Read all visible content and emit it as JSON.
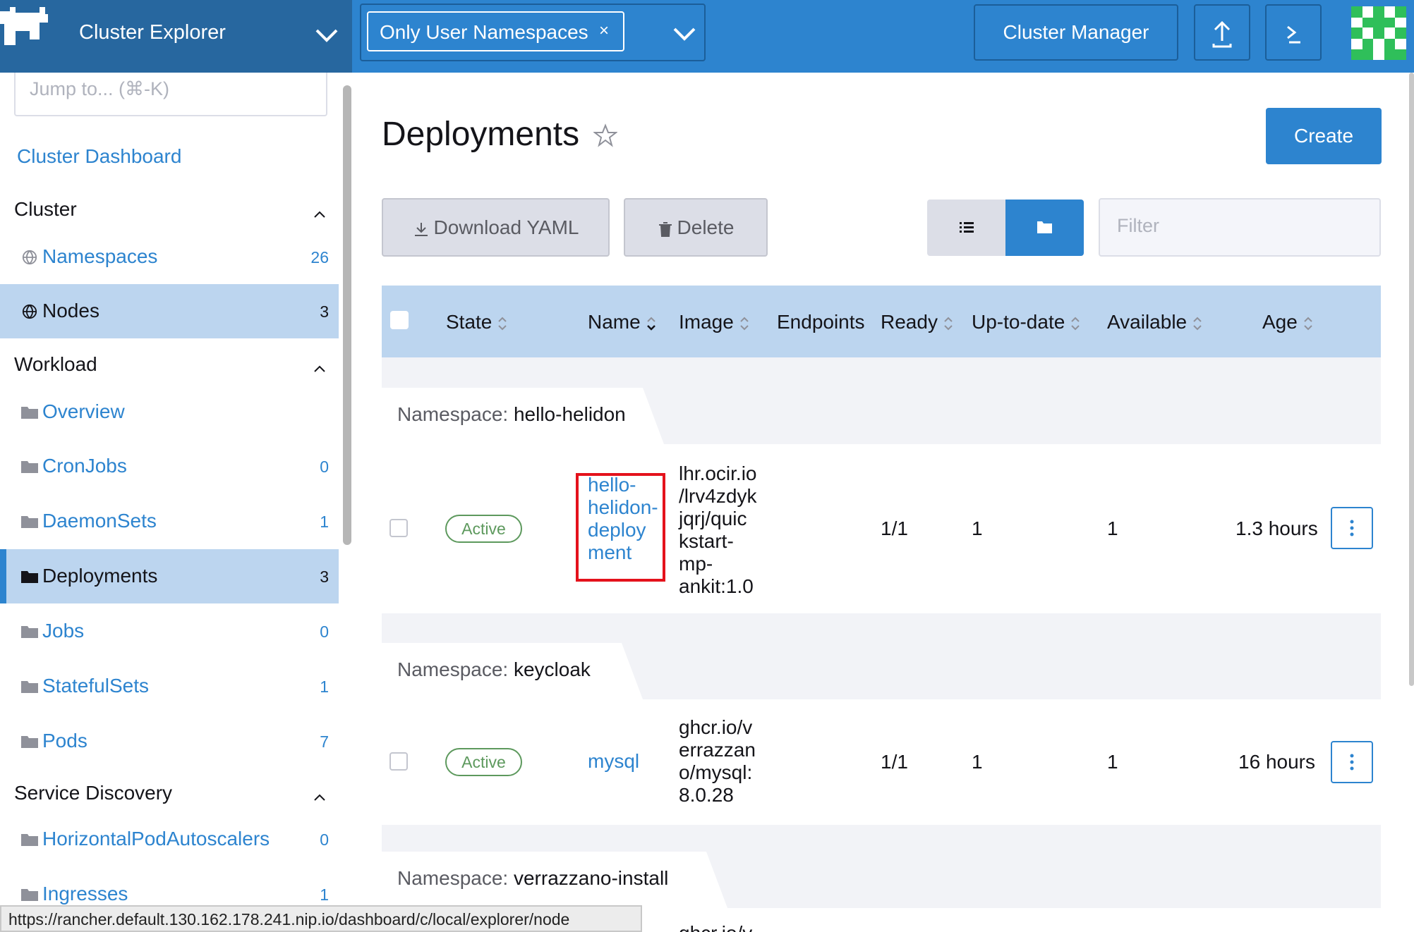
{
  "header": {
    "app_title": "Cluster Explorer",
    "namespace_filter": "Only User Namespaces",
    "namespace_remove": "×",
    "cluster_manager": "Cluster Manager",
    "colors": {
      "bar": "#2d84cf",
      "brand": "#27679f"
    }
  },
  "sidebar": {
    "jump_placeholder": "Jump to... (⌘-K)",
    "dashboard_link": "Cluster Dashboard",
    "sections": [
      {
        "title": "Cluster",
        "items": [
          {
            "label": "Namespaces",
            "count": "26",
            "icon": "globe-icon"
          },
          {
            "label": "Nodes",
            "count": "3",
            "icon": "globe-icon",
            "active": true
          }
        ]
      },
      {
        "title": "Workload",
        "items": [
          {
            "label": "Overview",
            "count": "",
            "icon": "folder-icon"
          },
          {
            "label": "CronJobs",
            "count": "0",
            "icon": "folder-icon"
          },
          {
            "label": "DaemonSets",
            "count": "1",
            "icon": "folder-icon"
          },
          {
            "label": "Deployments",
            "count": "3",
            "icon": "folder-icon",
            "active": true
          },
          {
            "label": "Jobs",
            "count": "0",
            "icon": "folder-icon"
          },
          {
            "label": "StatefulSets",
            "count": "1",
            "icon": "folder-icon"
          },
          {
            "label": "Pods",
            "count": "7",
            "icon": "folder-icon"
          }
        ]
      },
      {
        "title": "Service Discovery",
        "items": [
          {
            "label": "HorizontalPodAutoscalers",
            "count": "0",
            "icon": "folder-icon"
          },
          {
            "label": "Ingresses",
            "count": "1",
            "icon": "folder-icon"
          }
        ]
      }
    ]
  },
  "page": {
    "title": "Deployments",
    "create": "Create",
    "download_yaml": "Download YAML",
    "delete": "Delete",
    "filter_placeholder": "Filter"
  },
  "table": {
    "columns": [
      "State",
      "Name",
      "Image",
      "Endpoints",
      "Ready",
      "Up-to-date",
      "Available",
      "Age"
    ],
    "namespace_prefix": "Namespace:",
    "groups": [
      {
        "namespace": "hello-helidon",
        "rows": [
          {
            "state": "Active",
            "name_lines": [
              "hello-",
              "helidon-",
              "deploy",
              "ment"
            ],
            "image_lines": [
              "lhr.ocir.io",
              "/lrv4zdyk",
              "jqrj/quic",
              "kstart-",
              "mp-",
              "ankit:1.0"
            ],
            "ready": "1/1",
            "uptodate": "1",
            "available": "1",
            "age": "1.3 hours"
          }
        ]
      },
      {
        "namespace": "keycloak",
        "rows": [
          {
            "state": "Active",
            "name_lines": [
              "mysql"
            ],
            "image_lines": [
              "ghcr.io/v",
              "errazzan",
              "o/mysql:",
              "8.0.28"
            ],
            "ready": "1/1",
            "uptodate": "1",
            "available": "1",
            "age": "16 hours"
          }
        ]
      },
      {
        "namespace": "verrazzano-install",
        "rows": [
          {
            "partial_image": "ghcr.io/v"
          }
        ]
      }
    ]
  },
  "statusbar": {
    "url": "https://rancher.default.130.162.178.241.nip.io/dashboard/c/local/explorer/node"
  }
}
